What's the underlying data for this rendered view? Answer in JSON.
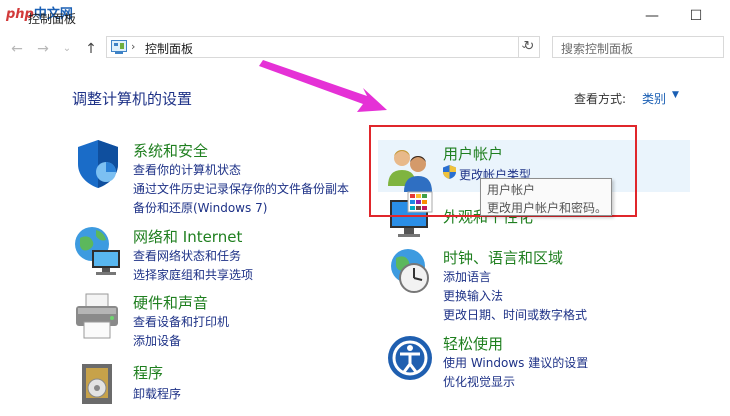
{
  "window": {
    "title": "控制面板",
    "watermark_en": "php",
    "watermark_cn": "中文网",
    "minimize_glyph": "—",
    "maximize_glyph": "☐"
  },
  "nav": {
    "back_glyph": "←",
    "forward_glyph": "→",
    "recent_glyph": "⌄",
    "up_glyph": "↑",
    "address_chevron": "›",
    "address_path": "控制面板",
    "address_dropdown": "⌄",
    "refresh_glyph": "↻",
    "search_placeholder": "搜索控制面板"
  },
  "header": {
    "page_title": "调整计算机的设置",
    "view_by_label": "查看方式:",
    "view_by_value": "类别",
    "view_by_caret": "▼"
  },
  "left_categories": [
    {
      "title": "系统和安全",
      "icon": "shield-icon",
      "links": [
        "查看你的计算机状态",
        "通过文件历史记录保存你的文件备份副本",
        "备份和还原(Windows 7)"
      ]
    },
    {
      "title": "网络和 Internet",
      "icon": "network-globe-icon",
      "links": [
        "查看网络状态和任务",
        "选择家庭组和共享选项"
      ]
    },
    {
      "title": "硬件和声音",
      "icon": "printer-icon",
      "links": [
        "查看设备和打印机",
        "添加设备"
      ]
    },
    {
      "title": "程序",
      "icon": "programs-icon",
      "links": [
        "卸载程序"
      ]
    }
  ],
  "right_categories": [
    {
      "title": "用户帐户",
      "icon": "users-icon",
      "links": [
        "更改帐户类型"
      ]
    },
    {
      "title": "外观和个性化",
      "icon": "monitor-palette-icon",
      "links": []
    },
    {
      "title": "时钟、语言和区域",
      "icon": "clock-globe-icon",
      "links": [
        "添加语言",
        "更换输入法",
        "更改日期、时间或数字格式"
      ]
    },
    {
      "title": "轻松使用",
      "icon": "ease-of-access-icon",
      "links": [
        "使用 Windows 建议的设置",
        "优化视觉显示"
      ]
    }
  ],
  "tooltip": {
    "line1": "用户帐户",
    "line2": "更改用户帐户和密码。"
  },
  "colors": {
    "category_green": "#1f7f1f",
    "link_blue": "#1e3287",
    "annotation_red": "#e0262b",
    "arrow_magenta": "#e531d6"
  }
}
